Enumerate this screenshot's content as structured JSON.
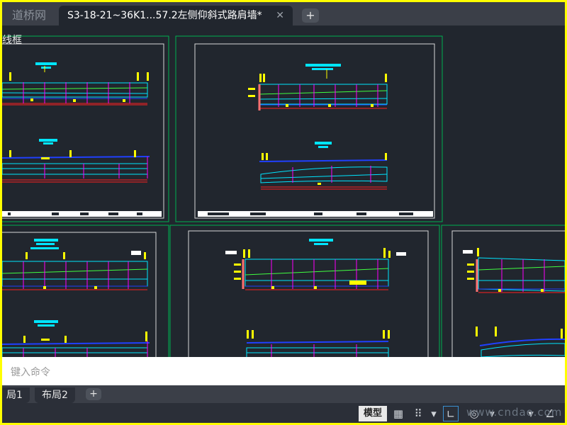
{
  "tabs": {
    "inactive_label": "道桥网",
    "active_label": "S3-18-21~36K1...57.2左侧仰斜式路肩墙*",
    "close_glyph": "✕",
    "add_glyph": "+"
  },
  "canvas": {
    "viewport_label": "线框",
    "background": "#21262e"
  },
  "command_line": {
    "placeholder": "键入命令"
  },
  "layout_tabs": [
    {
      "label": "局1"
    },
    {
      "label": "布局2"
    }
  ],
  "layout_add_glyph": "+",
  "status_bar": {
    "model_label": "模型",
    "icons": [
      "grid-icon",
      "snap-icon",
      "ortho-icon",
      "polar-icon",
      "dropdown-icon",
      "osnap-icon",
      "dropdown-icon",
      "drafting-icon"
    ],
    "watermark": "www.cndao.com"
  },
  "colors": {
    "frame_border": "#ffff00",
    "sheet_border": "#00b050",
    "cyan": "#00e5ff",
    "blue": "#2040ff",
    "magenta": "#ff00ff",
    "red": "#ff2020",
    "yellow": "#ffff00",
    "green": "#40ff40"
  }
}
